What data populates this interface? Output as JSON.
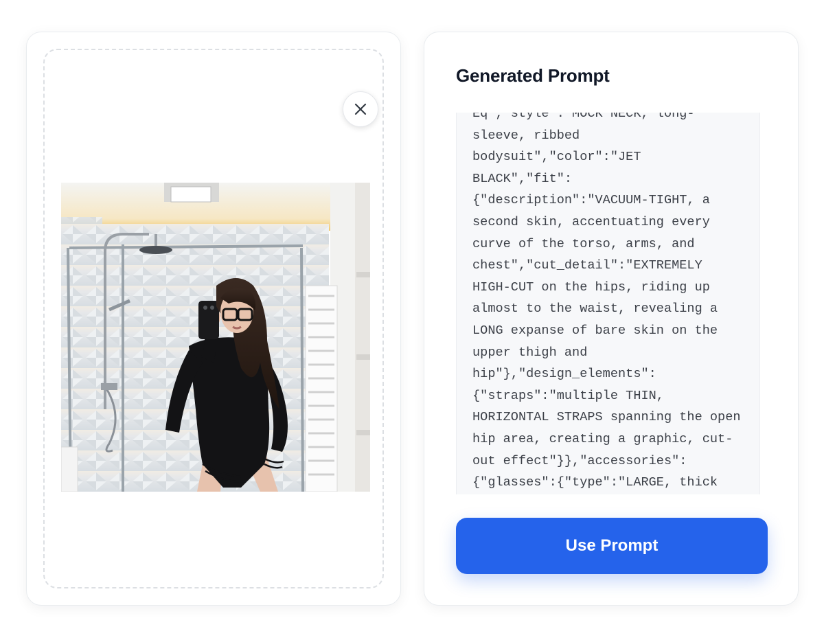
{
  "upload": {
    "close_icon": "close-icon",
    "photo_alt": ""
  },
  "prompt_panel": {
    "title": "Generated Prompt",
    "prompt_text": "Eq\",\"style\":\"MOCK NECK, long-sleeve, ribbed bodysuit\",\"color\":\"JET BLACK\",\"fit\":{\"description\":\"VACUUM-TIGHT, a second skin, accentuating every curve of the torso, arms, and chest\",\"cut_detail\":\"EXTREMELY HIGH-CUT on the hips, riding up almost to the waist, revealing a LONG expanse of bare skin on the upper thigh and hip\"},\"design_elements\":{\"straps\":\"multiple THIN, HORIZONTAL STRAPS spanning the open hip area, creating a graphic, cut-out effect\"}},\"accessories\":{\"glasses\":{\"type\":\"LARGE, thick",
    "use_button_label": "Use Prompt"
  },
  "colors": {
    "accent": "#2563eb",
    "title": "#111827",
    "prompt_text": "#3c4048",
    "prompt_bg": "#f7f8fa"
  }
}
